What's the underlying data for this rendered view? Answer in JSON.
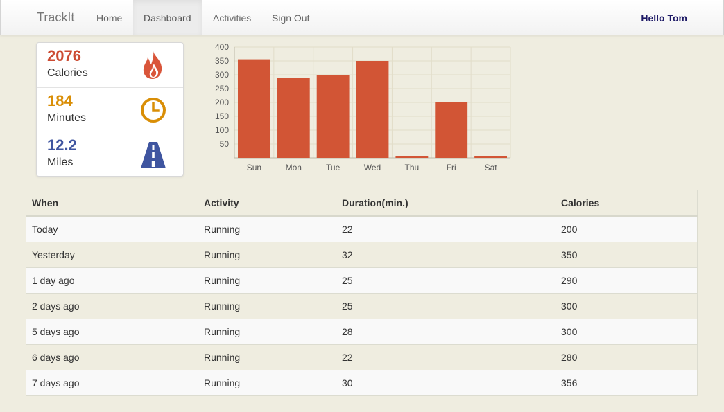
{
  "nav": {
    "brand": "TrackIt",
    "items": [
      {
        "label": "Home",
        "active": false
      },
      {
        "label": "Dashboard",
        "active": true
      },
      {
        "label": "Activities",
        "active": false
      },
      {
        "label": "Sign Out",
        "active": false
      }
    ],
    "greeting": "Hello Tom"
  },
  "stats": [
    {
      "value": "2076",
      "label": "Calories",
      "color": "#cc4b32",
      "icon": "flame-icon"
    },
    {
      "value": "184",
      "label": "Minutes",
      "color": "#d98e06",
      "icon": "clock-icon"
    },
    {
      "value": "12.2",
      "label": "Miles",
      "color": "#3f55a0",
      "icon": "road-icon"
    }
  ],
  "chart_data": {
    "type": "bar",
    "categories": [
      "Sun",
      "Mon",
      "Tue",
      "Wed",
      "Thu",
      "Fri",
      "Sat"
    ],
    "values": [
      356,
      290,
      300,
      350,
      0,
      200,
      0
    ],
    "ylim": [
      0,
      400
    ],
    "yticks": [
      "400",
      "350",
      "300",
      "250",
      "200",
      "150",
      "100",
      "50"
    ],
    "title": "",
    "xlabel": "",
    "ylabel": "",
    "grid": true,
    "bar_color": "#d25535"
  },
  "table": {
    "headers": [
      "When",
      "Activity",
      "Duration(min.)",
      "Calories"
    ],
    "rows": [
      [
        "Today",
        "Running",
        "22",
        "200"
      ],
      [
        "Yesterday",
        "Running",
        "32",
        "350"
      ],
      [
        "1 day ago",
        "Running",
        "25",
        "290"
      ],
      [
        "2 days ago",
        "Running",
        "25",
        "300"
      ],
      [
        "5 days ago",
        "Running",
        "28",
        "300"
      ],
      [
        "6 days ago",
        "Running",
        "22",
        "280"
      ],
      [
        "7 days ago",
        "Running",
        "30",
        "356"
      ]
    ]
  }
}
